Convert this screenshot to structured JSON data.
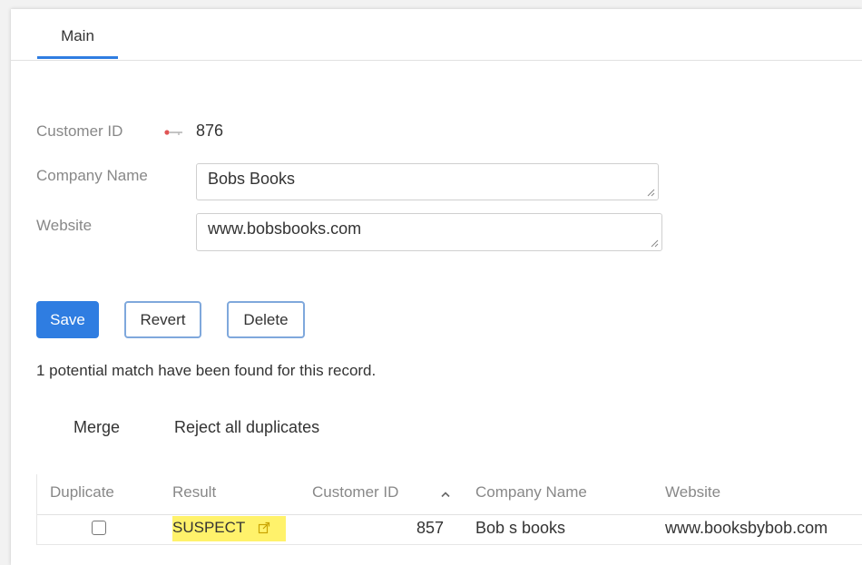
{
  "tabs": [
    {
      "label": "Main"
    }
  ],
  "form": {
    "customer_id_label": "Customer ID",
    "customer_id_value": "876",
    "customer_id_icon": "key-icon",
    "company_name_label": "Company Name",
    "company_name_value": "Bobs Books",
    "website_label": "Website",
    "website_value": "www.bobsbooks.com"
  },
  "buttons": {
    "save": "Save",
    "revert": "Revert",
    "delete": "Delete"
  },
  "notice": "1 potential match have been found for this record.",
  "actions": {
    "merge": "Merge",
    "reject_all": "Reject all duplicates"
  },
  "table": {
    "columns": [
      "Duplicate",
      "Result",
      "Customer ID",
      "Company Name",
      "Website"
    ],
    "sort_icon": "sort-ascending-icon",
    "rows": [
      {
        "duplicate_checked": false,
        "result": "SUSPECT",
        "result_icon": "external-link-icon",
        "customer_id": "857",
        "company_name": "Bob s books",
        "website": "www.booksbybob.com"
      }
    ]
  },
  "colors": {
    "accent": "#2f7de1",
    "suspect_highlight": "#fff26b"
  }
}
